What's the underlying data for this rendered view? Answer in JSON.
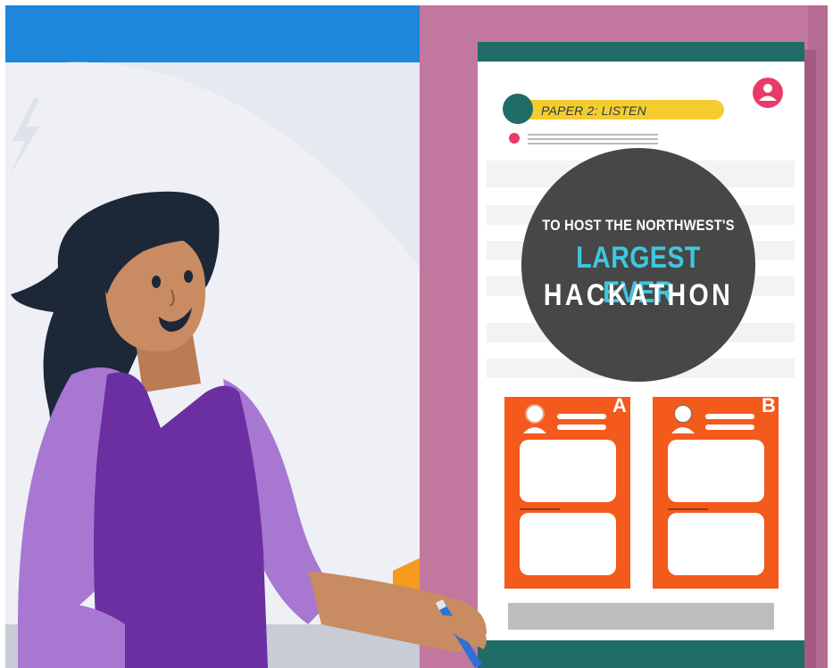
{
  "worksheet": {
    "tag_label": "PAPER 2: LISTEN",
    "headline": {
      "line1": "TO HOST THE NORTHWEST'S",
      "line2": "LARGEST EVER",
      "line3": "HACKATHON"
    },
    "cards": [
      {
        "letter": "A"
      },
      {
        "letter": "B"
      }
    ]
  },
  "icons": [
    "user-avatar-icon",
    "lightning-icon",
    "pen-icon"
  ],
  "colors": {
    "top_bar": "#1e86db",
    "room_wall": "#e6e9ef",
    "frame": "#c2779f",
    "teal_bar": "#1f6d66",
    "yellow_tag": "#f4cc2f",
    "card_orange": "#f35a1c",
    "circle_dark": "#474747",
    "accent_cyan": "#3ec7df",
    "shirt": "#6b2fa1",
    "sleeve": "#a777d2",
    "skin": "#c98b61",
    "hair": "#1c2838"
  }
}
